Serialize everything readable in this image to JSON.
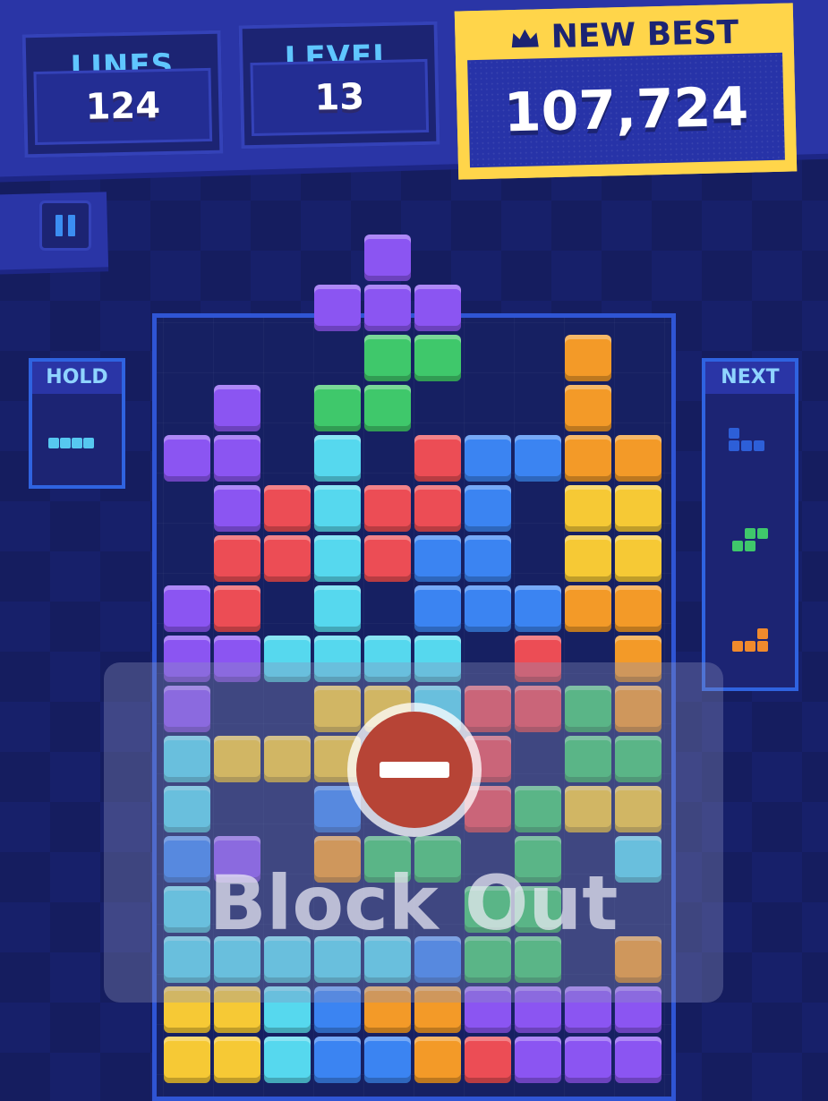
{
  "stats": {
    "lines_label": "LINES",
    "lines_value": "124",
    "level_label": "LEVEL",
    "level_value": "13",
    "best_label": "NEW BEST",
    "best_value": "107,724",
    "best_icon": "crown-icon"
  },
  "controls": {
    "pause_icon": "pause-icon"
  },
  "hold": {
    "title": "HOLD",
    "piece": "I"
  },
  "next": {
    "title": "NEXT",
    "pieces": [
      "J",
      "S",
      "L"
    ]
  },
  "colors": {
    "accent": "#2f55d4",
    "best_gold": "#ffd54a",
    "purple": "#8b55f2",
    "green": "#3fc86b",
    "orange": "#f39a28",
    "red": "#ec4d55",
    "cyan": "#56d8ee",
    "blue": "#3b84f2",
    "yellow": "#f6c935"
  },
  "game_over": {
    "message": "Block Out",
    "icon": "no-entry-icon"
  },
  "board": {
    "columns": 10,
    "overflow_rows": [
      ". . . . o . . . . .",
      ". . . o o o . . . ."
    ],
    "rows": [
      ". . . . g g . . L .",
      ". o . g g . . . L .",
      "o o . c . r b b L L",
      ". o r c r r b . Y Y",
      ". r r c r b b . Y Y",
      "o r . c . b b b L L",
      "o o c c c c . r . L",
      "o . . Y Y c r r g L",
      "c Y Y Y . . r . g g",
      "c . . b . . r g Y Y",
      "b o . L g g . g . c",
      "c . . . . . g g . .",
      "c c c c c b g g . L",
      "Y Y c b L L o o o o",
      "Y Y c b b L r o o o"
    ]
  }
}
